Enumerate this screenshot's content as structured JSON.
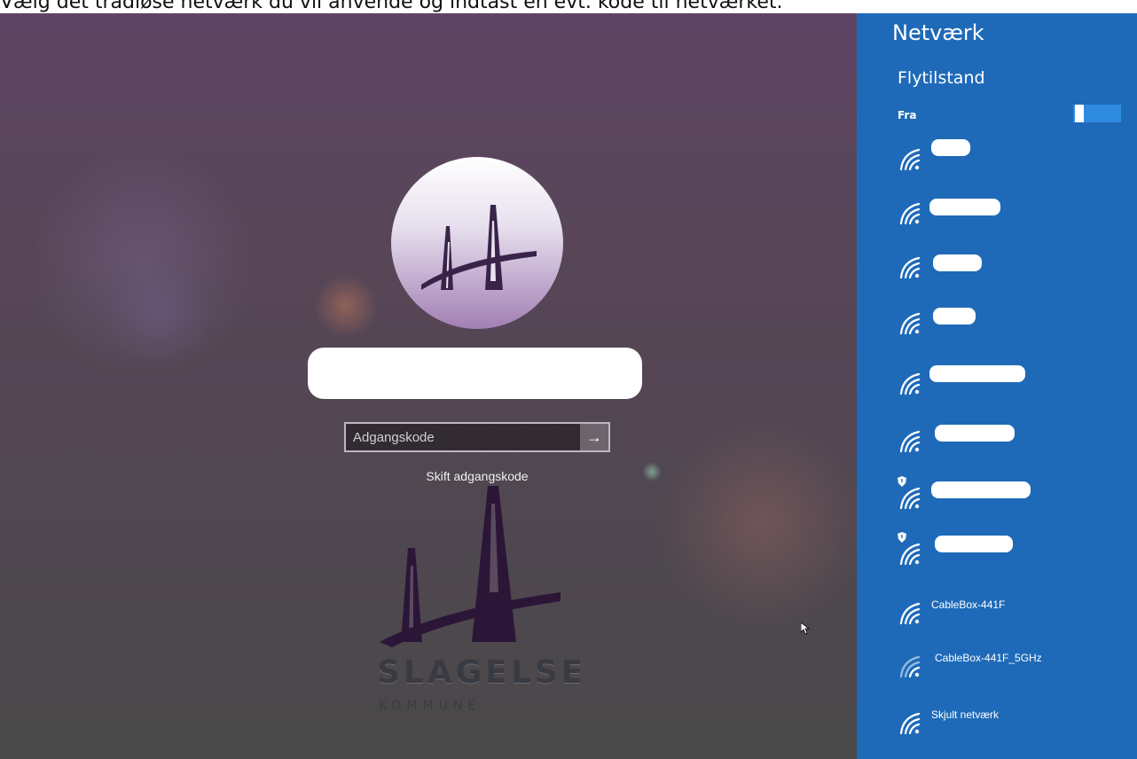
{
  "caption": "Vælg det trådløse netværk du vil anvende og indtast en evt. kode til netværket.",
  "login": {
    "password_placeholder": "Adgangskode",
    "submit_arrow": "→",
    "change_password": "Skift adgangskode"
  },
  "logo": {
    "name": "SLAGELSE",
    "subtitle": "KOMMUNE"
  },
  "panel": {
    "title": "Netværk",
    "airplane_mode_label": "Flytilstand",
    "airplane_mode_state": "Fra",
    "networks": [
      {
        "ssid": "CableBox-441F"
      },
      {
        "ssid": "CableBox-441F_5GHz"
      },
      {
        "ssid": "Skjult netværk"
      }
    ]
  },
  "colors": {
    "panel_bg": "#1e6ab8",
    "toggle_bg": "#2f8be0",
    "lockscreen_top": "#5e4564",
    "lockscreen_bottom": "#4a4949"
  }
}
